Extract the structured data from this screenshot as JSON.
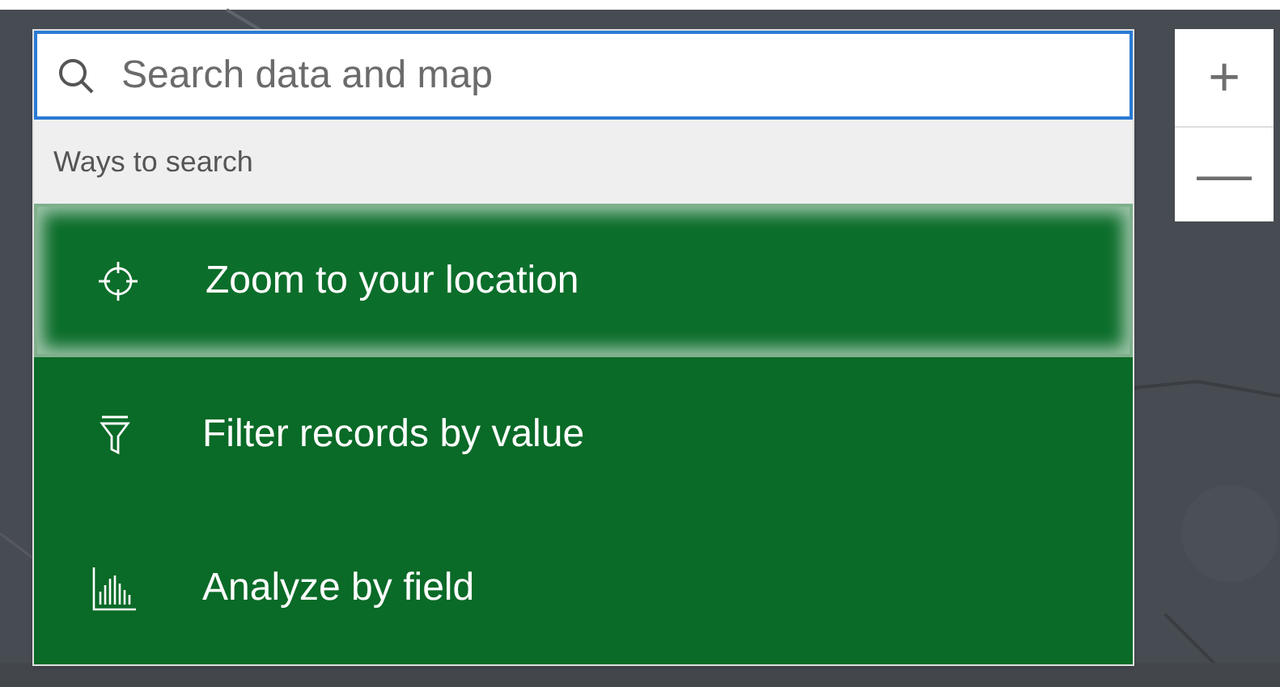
{
  "search": {
    "placeholder": "Search data and map"
  },
  "menu": {
    "header": "Ways to search",
    "items": [
      {
        "kind": "locate",
        "label": "Zoom to your location",
        "selected": true
      },
      {
        "kind": "filter",
        "label": "Filter records by value",
        "selected": false
      },
      {
        "kind": "chart",
        "label": "Analyze by field",
        "selected": false
      }
    ]
  },
  "zoom_controls": [
    {
      "label": "+"
    },
    {
      "label": "—"
    }
  ]
}
